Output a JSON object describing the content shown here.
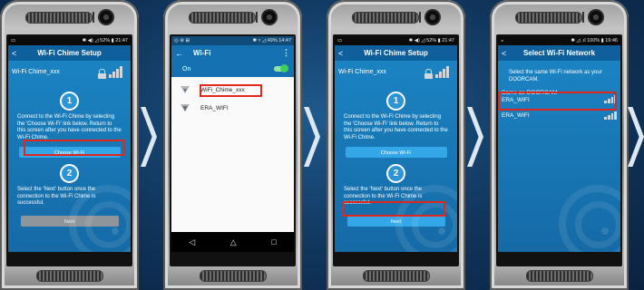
{
  "phones": [
    {
      "status": {
        "left": "▭",
        "right": "✱ ◀) ◿ 52% ▮ 21:47"
      },
      "header": {
        "title": "Wi-Fi Chime Setup",
        "back": "<"
      },
      "device_name": "Wi-Fi Chime_xxx",
      "steps": [
        "1",
        "2"
      ],
      "step1_text": "Connect to the Wi-Fi Chime by selecting the 'Choose Wi-Fi' link below. Return to this screen after you have connected to the Wi-Fi Chime.",
      "choose_wifi_button": "Choose Wi-Fi",
      "step2_text": "Select the 'Next' button once the connection to the Wi-Fi Chime is successful.",
      "next_button": "Next"
    },
    {
      "status": {
        "left": "◎ ⊛ ⊞",
        "right": "✱ ▿ ◿ 49% 14:47"
      },
      "header": {
        "title": "Wi-Fi",
        "back": "←",
        "menu": "⋮"
      },
      "toggle_label": "On",
      "networks": [
        "WiFi_Chime_xxx",
        "ERA_WIFI"
      ],
      "nav": {
        "back": "◁",
        "home": "△",
        "recent": "□"
      }
    },
    {
      "status": {
        "left": "▭",
        "right": "✱ ◀) ◿ 52% ▮ 21:47"
      },
      "header": {
        "title": "Wi-Fi Chime Setup",
        "back": "<"
      },
      "device_name": "Wi-Fi Chime_xxx",
      "steps": [
        "1",
        "2"
      ],
      "step1_text": "Connect to the Wi-Fi Chime by selecting the 'Choose Wi-Fi' link below. Return to this screen after you have connected to the Wi-Fi Chime.",
      "choose_wifi_button": "Choose Wi-Fi",
      "step2_text": "Select the 'Next' button once the connection to the Wi-Fi Chime is successful.",
      "next_button": "Next"
    },
    {
      "status": {
        "left": "◒",
        "right": "✱ ◿ .ıl 100% ▮ 19:46"
      },
      "header": {
        "title": "Select Wi-Fi Network",
        "back": "<"
      },
      "instruction": "Select the same Wi-Fi network as your DOORCAM.",
      "same_as_label": "Same as DOORCAM",
      "selected_network": "ERA_WIFI",
      "other_network": "ERA_WIFI"
    }
  ],
  "colors": {
    "background": "#10355c",
    "accent_blue": "#1c86c6",
    "highlight_red": "#e1261c",
    "toggle_green": "#3ad25f"
  }
}
